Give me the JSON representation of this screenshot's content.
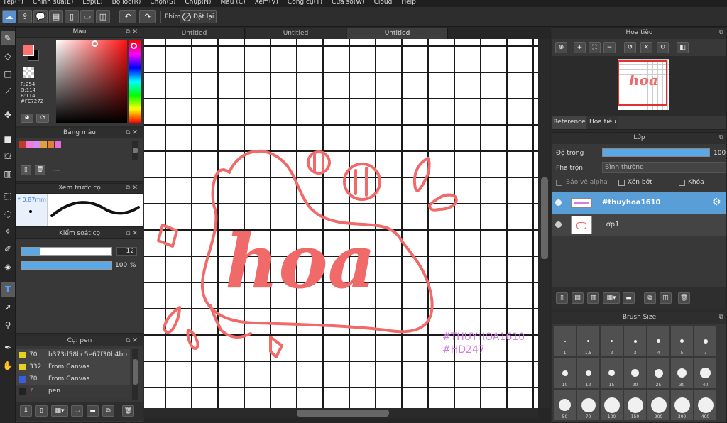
{
  "menu": [
    "Tệp(F)",
    "Chỉnh sửa(E)",
    "Lớp(L)",
    "Bộ lọc(R)",
    "Chọn(S)",
    "Chụp(N)",
    "Màu (C)",
    "Xem(V)",
    "Công cụ(T)",
    "Cửa sổ(W)",
    "Cloud",
    "Help"
  ],
  "toolbar": {
    "phim_label": "Phím",
    "reset_label": "Đặt lại"
  },
  "color_panel": {
    "title": "Màu",
    "r": "R:254",
    "g": "G:114",
    "b": "B:114",
    "hex": "#FE7272",
    "current": "#fe7272"
  },
  "palette": {
    "title": "Bảng màu",
    "dash": "---",
    "swatches": [
      "#c0392b",
      "#f07bd8",
      "#d98cf0",
      "#e0a040",
      "#e08030",
      "#e86bd8"
    ]
  },
  "brush_preview": {
    "title": "Xem trước cọ",
    "size": "* 0.87mm"
  },
  "brush_control": {
    "title": "Kiểm soát cọ",
    "size_value": "12",
    "opacity_value": "100",
    "opacity_unit": "%",
    "size_fraction": 0.2,
    "opacity_fraction": 1.0
  },
  "brush_list": {
    "title": "Cọ: pen",
    "items": [
      {
        "num": "70",
        "name": "b373d58bc5e67f30b4bb",
        "color": "#e8d020"
      },
      {
        "num": "332",
        "name": "From Canvas",
        "color": "#e8d020"
      },
      {
        "num": "70",
        "name": "From Canvas",
        "color": "#3a5de0"
      },
      {
        "num": "7",
        "name": "pen",
        "color": "#222222"
      }
    ]
  },
  "canvas_tabs": [
    "Untitled",
    "Untitled",
    "Untitled"
  ],
  "artwork": {
    "word": "hoa",
    "watermark_1": "#THUYHOA1610",
    "watermark_2": "#HD247",
    "ink": "#f06a6a"
  },
  "navigator": {
    "title": "Hoa tiêu",
    "tabs": [
      "Reference",
      "Hoa tiêu"
    ]
  },
  "layers": {
    "title": "Lớp",
    "opacity_label": "Độ trong",
    "opacity_value": "100 %",
    "opacity_fraction": 1.0,
    "blend_label": "Pha trộn",
    "blend_value": "Bình thường",
    "protect_alpha": "Bảo vệ alpha",
    "clip": "Xén bớt",
    "lock": "Khóa",
    "items": [
      {
        "name": "#thuyhoa1610",
        "selected": true
      },
      {
        "name": "Lớp1",
        "selected": false
      }
    ]
  },
  "brush_size": {
    "title": "Brush Size",
    "sizes": [
      "1",
      "1.5",
      "2",
      "3",
      "4",
      "5",
      "7",
      "10",
      "12",
      "15",
      "20",
      "25",
      "30",
      "40",
      "50",
      "70",
      "100",
      "150",
      "200",
      "300",
      "400"
    ]
  }
}
